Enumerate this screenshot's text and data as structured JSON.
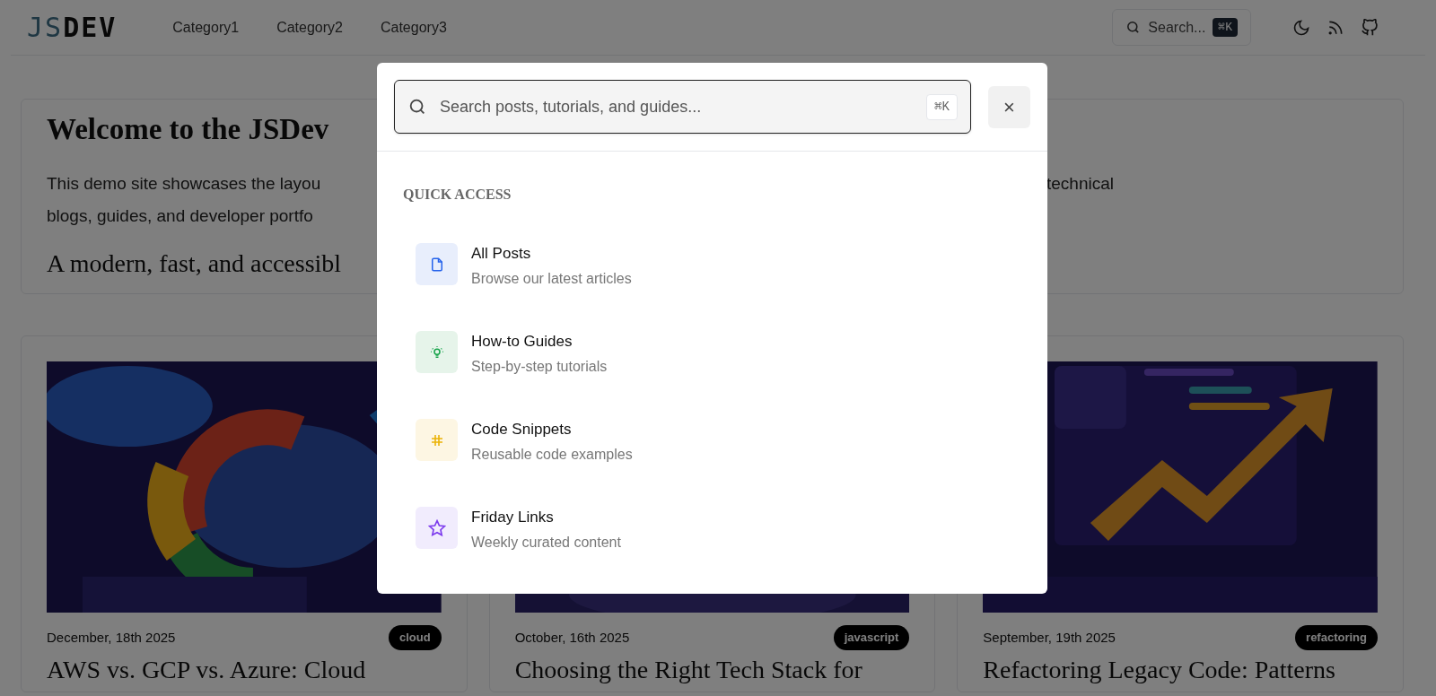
{
  "header": {
    "logo": {
      "accent": "JS",
      "rest": "DEV"
    },
    "nav": [
      "Category1",
      "Category2",
      "Category3"
    ],
    "search": {
      "placeholder": "Search...",
      "shortcut": "⌘K"
    }
  },
  "hero": {
    "title": "Welcome to the JSDev",
    "lines": [
      {
        "left": "This demo site showcases the layou",
        "right": "technical"
      },
      {
        "left": "blogs, guides, and developer portfo"
      }
    ],
    "tagline": "A modern, fast, and accessibl"
  },
  "posts": [
    {
      "date": "December, 18th 2025",
      "tag": "cloud",
      "title": "AWS vs. GCP vs. Azure: Cloud"
    },
    {
      "date": "October, 16th 2025",
      "tag": "javascript",
      "title": "Choosing the Right Tech Stack for"
    },
    {
      "date": "September, 19th 2025",
      "tag": "refactoring",
      "title": "Refactoring Legacy Code: Patterns"
    }
  ],
  "search_modal": {
    "placeholder": "Search posts, tutorials, and guides...",
    "shortcut": "⌘K",
    "close": "×",
    "section": "QUICK ACCESS",
    "items": [
      {
        "kind": "document",
        "title": "All Posts",
        "subtitle": "Browse our latest articles"
      },
      {
        "kind": "bulb",
        "title": "How-to Guides",
        "subtitle": "Step-by-step tutorials"
      },
      {
        "kind": "hash",
        "title": "Code Snippets",
        "subtitle": "Reusable code examples"
      },
      {
        "kind": "star",
        "title": "Friday Links",
        "subtitle": "Weekly curated content"
      }
    ]
  }
}
